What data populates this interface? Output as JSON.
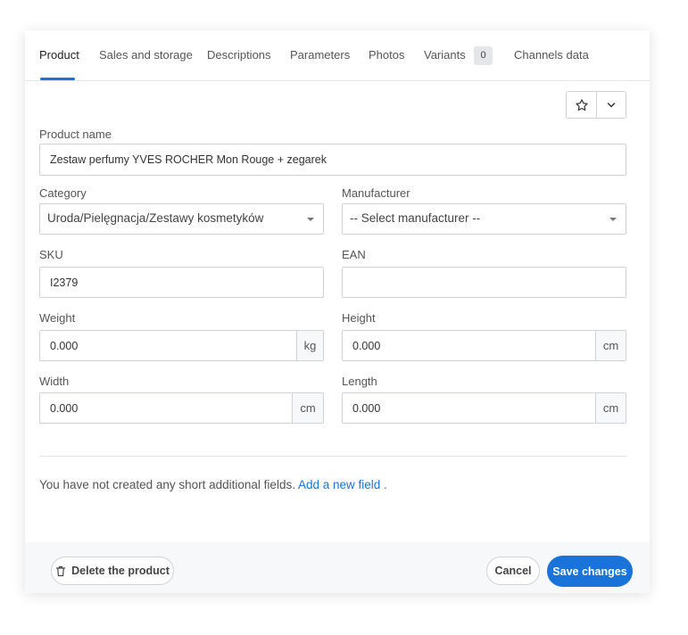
{
  "tabs": [
    {
      "label": "Product",
      "active": true
    },
    {
      "label": "Sales and storage"
    },
    {
      "label": "Descriptions"
    },
    {
      "label": "Parameters"
    },
    {
      "label": "Photos"
    },
    {
      "label": "Variants",
      "badge": "0"
    },
    {
      "label": "Channels data"
    }
  ],
  "toolbar": {
    "favorite_icon": "star-icon",
    "menu_icon": "chevron-down-icon"
  },
  "form": {
    "product_name": {
      "label": "Product name",
      "value": "Zestaw perfumy YVES ROCHER Mon Rouge + zegarek"
    },
    "category": {
      "label": "Category",
      "value": "Uroda/Pielęgnacja/Zestawy kosmetyków"
    },
    "manufacturer": {
      "label": "Manufacturer",
      "value": "-- Select manufacturer --"
    },
    "sku": {
      "label": "SKU",
      "value": "I2379"
    },
    "ean": {
      "label": "EAN",
      "value": ""
    },
    "weight": {
      "label": "Weight",
      "value": "0.000",
      "unit": "kg"
    },
    "height": {
      "label": "Height",
      "value": "0.000",
      "unit": "cm"
    },
    "width": {
      "label": "Width",
      "value": "0.000",
      "unit": "cm"
    },
    "length": {
      "label": "Length",
      "value": "0.000",
      "unit": "cm"
    }
  },
  "additional_fields": {
    "message": "You have not created any short additional fields.",
    "link": "Add a new field",
    "suffix": "."
  },
  "footer": {
    "delete_label": "Delete the product",
    "cancel_label": "Cancel",
    "save_label": "Save changes"
  },
  "colors": {
    "accent": "#1a73d9",
    "border": "#cfd3d8",
    "footer_bg": "#f7f8fa"
  }
}
